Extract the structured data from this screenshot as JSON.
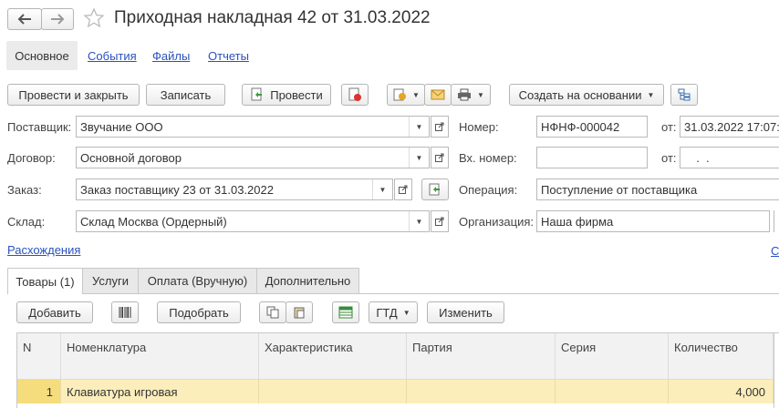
{
  "header": {
    "title": "Приходная накладная 42 от 31.03.2022",
    "back_icon": "arrow-left-icon",
    "forward_icon": "arrow-right-icon",
    "favorite_icon": "star-icon"
  },
  "nav_tabs": [
    {
      "label": "Основное"
    },
    {
      "label": "События"
    },
    {
      "label": "Файлы"
    },
    {
      "label": "Отчеты"
    }
  ],
  "toolbar": {
    "post_close_label": "Провести и закрыть",
    "save_label": "Записать",
    "post_label": "Провести",
    "create_based_label": "Создать на основании"
  },
  "form": {
    "supplier_label": "Поставщик:",
    "supplier_value": "Звучание ООО",
    "contract_label": "Договор:",
    "contract_value": "Основной договор",
    "order_label": "Заказ:",
    "order_value": "Заказ поставщику 23 от 31.03.2022",
    "warehouse_label": "Склад:",
    "warehouse_value": "Склад Москва (Ордерный)",
    "number_label": "Номер:",
    "number_value": "НФНФ-000042",
    "from_label": "от:",
    "date_value": "31.03.2022 17:07:",
    "in_number_label": "Вх. номер:",
    "in_number_value": "",
    "in_from_label": "от:",
    "in_date_value": "  .  .",
    "operation_label": "Операция:",
    "operation_value": "Поступление от поставщика",
    "organization_label": "Организация:",
    "organization_value": "Наша фирма",
    "discrepancies_link": "Расхождения",
    "right_link": "С"
  },
  "content_tabs": [
    {
      "label": "Товары (1)"
    },
    {
      "label": "Услуги"
    },
    {
      "label": "Оплата (Вручную)"
    },
    {
      "label": "Дополнительно"
    }
  ],
  "table_toolbar": {
    "add_label": "Добавить",
    "pick_label": "Подобрать",
    "gtd_label": "ГТД",
    "change_label": "Изменить"
  },
  "table": {
    "columns": [
      "N",
      "Номенклатура",
      "Характеристика",
      "Партия",
      "Серия",
      "Количество"
    ],
    "rows": [
      {
        "n": "1",
        "item": "Клавиатура игровая",
        "characteristic": "",
        "batch": "",
        "series": "",
        "quantity": "4,000"
      }
    ]
  },
  "colors": {
    "accent_link": "#2a52be",
    "selected_row": "#fbeebb",
    "header_bg": "#f2f2f2"
  }
}
